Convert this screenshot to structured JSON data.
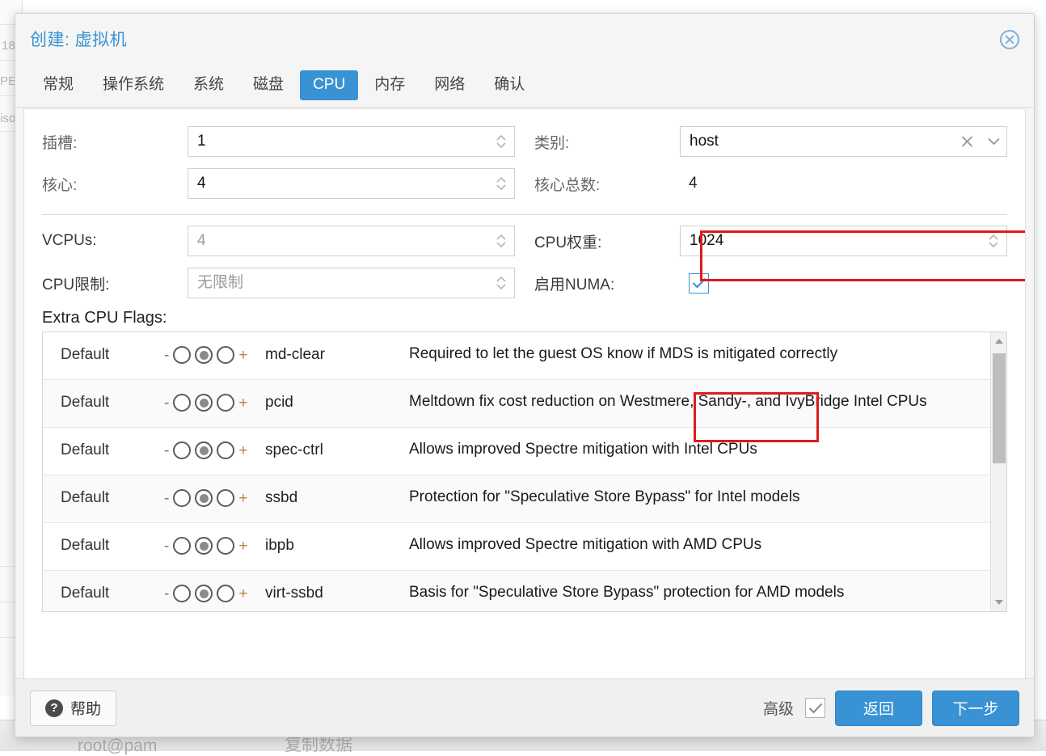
{
  "background": {
    "fragments": [
      "18",
      "PE",
      "iso"
    ],
    "bottom_left": "root@pam",
    "bottom_mid": "复制数据"
  },
  "dialog": {
    "title": "创建: 虚拟机",
    "close_icon": "close-circle-icon"
  },
  "tabs": [
    {
      "label": "常规",
      "active": false
    },
    {
      "label": "操作系统",
      "active": false
    },
    {
      "label": "系统",
      "active": false
    },
    {
      "label": "磁盘",
      "active": false
    },
    {
      "label": "CPU",
      "active": true
    },
    {
      "label": "内存",
      "active": false
    },
    {
      "label": "网络",
      "active": false
    },
    {
      "label": "确认",
      "active": false
    }
  ],
  "form": {
    "sockets": {
      "label": "插槽:",
      "value": "1"
    },
    "cores": {
      "label": "核心:",
      "value": "4"
    },
    "type": {
      "label": "类别:",
      "value": "host",
      "clear_icon": "clear-x-icon",
      "expand_icon": "chevron-down-icon",
      "highlighted": true
    },
    "total_cores": {
      "label": "核心总数:",
      "value": "4"
    },
    "vcpus": {
      "label": "VCPUs:",
      "value": "4"
    },
    "cpu_limit": {
      "label": "CPU限制:",
      "value": "无限制"
    },
    "cpu_units": {
      "label": "CPU权重:",
      "value": "1024"
    },
    "enable_numa": {
      "label": "启用NUMA:",
      "checked": true,
      "highlighted": true
    }
  },
  "flags": {
    "title": "Extra CPU Flags:",
    "state_label": "Default",
    "minus": "-",
    "plus": "+",
    "rows": [
      {
        "state": "Default",
        "name": "md-clear",
        "desc": "Required to let the guest OS know if MDS is mitigated correctly"
      },
      {
        "state": "Default",
        "name": "pcid",
        "desc": "Meltdown fix cost reduction on Westmere, Sandy-, and IvyBridge Intel CPUs"
      },
      {
        "state": "Default",
        "name": "spec-ctrl",
        "desc": "Allows improved Spectre mitigation with Intel CPUs"
      },
      {
        "state": "Default",
        "name": "ssbd",
        "desc": "Protection for \"Speculative Store Bypass\" for Intel models"
      },
      {
        "state": "Default",
        "name": "ibpb",
        "desc": "Allows improved Spectre mitigation with AMD CPUs"
      },
      {
        "state": "Default",
        "name": "virt-ssbd",
        "desc": "Basis for \"Speculative Store Bypass\" protection for AMD models"
      }
    ]
  },
  "footer": {
    "help_label": "帮助",
    "help_icon": "question-mark-icon",
    "advanced_label": "高级",
    "advanced_checked": true,
    "back_label": "返回",
    "next_label": "下一步"
  },
  "colors": {
    "accent": "#3892d4",
    "highlight": "#e01b1b",
    "title": "#3892d4"
  }
}
